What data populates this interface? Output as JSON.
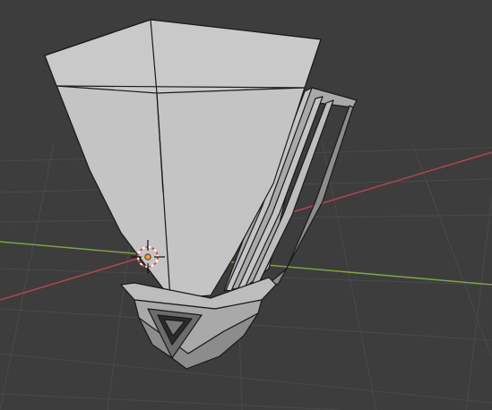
{
  "viewport": {
    "background": "#3d3d3d",
    "grid_color": "#4a4a4a",
    "x_axis_color": "#b5434f",
    "y_axis_color": "#7ea53c"
  },
  "object": {
    "face_color": "#c4c4c4",
    "face_shade_color": "#a9a9a9",
    "face_dark_color": "#8c8c8c",
    "edge_color": "#1a1a1a"
  },
  "cursor": {
    "icon": "3d-cursor-icon",
    "ring_color_a": "#e0473f",
    "ring_color_b": "#ffffff",
    "origin_color": "#ff9a1f"
  }
}
